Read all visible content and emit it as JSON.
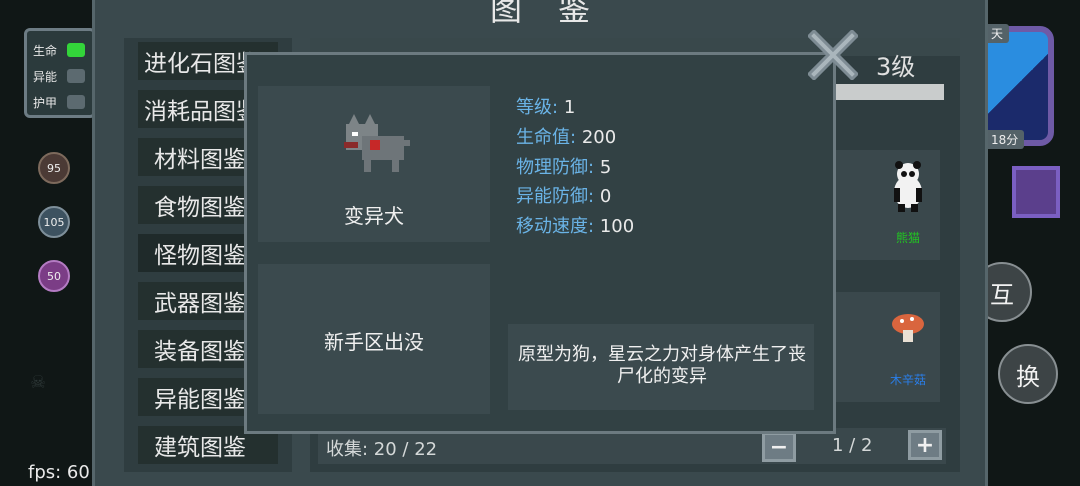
{
  "hud": {
    "bars": [
      {
        "label": "生命",
        "state": "full"
      },
      {
        "label": "异能",
        "state": "empty"
      },
      {
        "label": "护甲",
        "state": "empty"
      }
    ],
    "items": [
      "95",
      "105",
      "50"
    ],
    "fps": "fps: 60"
  },
  "minimap": {
    "tag": "天",
    "time": "18分"
  },
  "buttons": {
    "interact": "互",
    "swap": "换"
  },
  "panel": {
    "title": "图鉴",
    "nav": [
      "进化石图鉴",
      "消耗品图鉴",
      "材料图鉴",
      "食物图鉴",
      "怪物图鉴",
      "武器图鉴",
      "装备图鉴",
      "异能图鉴",
      "建筑图鉴"
    ],
    "level_label": "3级",
    "grid_labels": [
      "熊猫",
      "木辛菇"
    ],
    "collect": "收集: 20 / 22",
    "page": "1 / 2",
    "page_prev": "−",
    "page_next": "+"
  },
  "dialog": {
    "name": "变异犬",
    "spawn": "新手区出没",
    "stats": [
      {
        "k": "等级:",
        "v": "1"
      },
      {
        "k": "生命值:",
        "v": "200"
      },
      {
        "k": "物理防御:",
        "v": "5"
      },
      {
        "k": "异能防御:",
        "v": "0"
      },
      {
        "k": "移动速度:",
        "v": "100"
      }
    ],
    "desc": "原型为狗，星云之力对身体产生了丧尸化的变异"
  },
  "colors": {
    "accent": "#6ab3e6",
    "panel": "#3a494d",
    "dialog": "#324144",
    "green_label": "#22c422",
    "blue_label": "#2a7ee8"
  }
}
